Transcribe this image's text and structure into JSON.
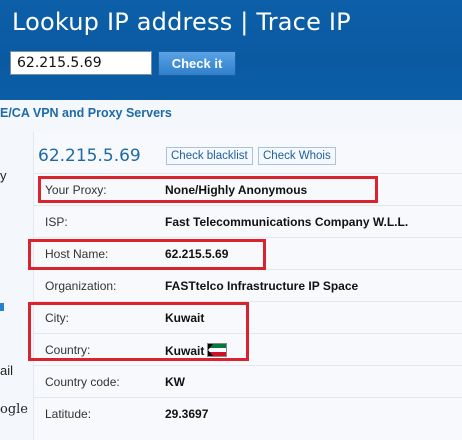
{
  "header": {
    "title": "Lookup IP address | Trace IP",
    "ip_input_value": "62.215.5.69",
    "check_button": "Check it"
  },
  "nav": {
    "vpn_link": "E/CA VPN and Proxy Servers"
  },
  "sidebar_fragments": [
    "y",
    "ail",
    "ogle"
  ],
  "result": {
    "ip": "62.215.5.69",
    "check_blacklist": "Check blacklist",
    "check_whois": "Check Whois",
    "rows": [
      {
        "label": "Your Proxy:",
        "value": "None/Highly Anonymous"
      },
      {
        "label": "ISP:",
        "value": "Fast Telecommunications Company W.L.L."
      },
      {
        "label": "Host Name:",
        "value": "62.215.5.69"
      },
      {
        "label": "Organization:",
        "value": "FASTtelco Infrastructure IP Space"
      },
      {
        "label": "City:",
        "value": "Kuwait"
      },
      {
        "label": "Country:",
        "value": "Kuwait",
        "flag": "kuwait-flag-icon"
      },
      {
        "label": "Country code:",
        "value": "KW"
      },
      {
        "label": "Latitude:",
        "value": "29.3697"
      }
    ]
  },
  "colors": {
    "header_blue": "#0b5ea6",
    "link_blue": "#1e6aa8",
    "highlight_red": "#d9242e",
    "button_blue": "#3d8bd6"
  }
}
